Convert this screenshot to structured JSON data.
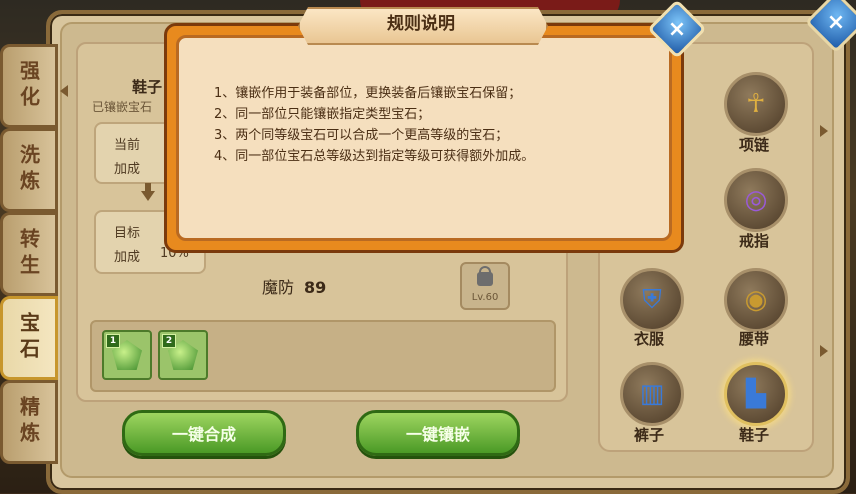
{
  "tabs": [
    {
      "label": "强化",
      "active": false
    },
    {
      "label": "洗炼",
      "active": false
    },
    {
      "label": "转生",
      "active": false
    },
    {
      "label": "宝石",
      "active": true
    },
    {
      "label": "精炼",
      "active": false
    }
  ],
  "left_panel": {
    "slot_title": "鞋子",
    "slot_subtitle": "已镶嵌宝石",
    "current_label_1": "当前",
    "current_label_2": "加成",
    "target_label_1": "目标",
    "target_label_2": "加成",
    "target_value": "10%",
    "magic_def_label": "魔防",
    "magic_def_value": "89",
    "lock_level": "Lv.60",
    "gems": [
      {
        "slot": "1"
      },
      {
        "slot": "2"
      }
    ]
  },
  "buttons": {
    "combine_all": "一键合成",
    "inlay_all": "一键镶嵌"
  },
  "equipment": [
    {
      "label": "项链"
    },
    {
      "label": "戒指"
    },
    {
      "label": "衣服"
    },
    {
      "label": "腰带"
    },
    {
      "label": "裤子"
    },
    {
      "label": "鞋子",
      "selected": true
    }
  ],
  "dialog": {
    "title": "规则说明",
    "close_symbol": "×",
    "rules": [
      "1、镶嵌作用于装备部位，更换装备后镶嵌宝石保留；",
      "2、同一部位只能镶嵌指定类型宝石；",
      "3、两个同等级宝石可以合成一个更高等级的宝石；",
      "4、同一部位宝石总等级达到指定等级可获得额外加成。"
    ]
  },
  "main_close_symbol": "×"
}
